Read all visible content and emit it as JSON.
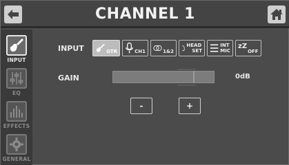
{
  "header": {
    "title": "CHANNEL 1",
    "back_icon": "arrow-left-icon",
    "home_icon": "home-icon"
  },
  "sidebar": {
    "items": [
      {
        "label": "INPUT",
        "icon": "guitar-icon",
        "active": true
      },
      {
        "label": "EQ",
        "icon": "eq-sliders-icon",
        "active": false
      },
      {
        "label": "EFFECTS",
        "icon": "effects-bars-icon",
        "active": false
      },
      {
        "label": "GENERAL",
        "icon": "gear-icon",
        "active": false
      }
    ]
  },
  "input": {
    "label": "INPUT",
    "options": [
      {
        "icon": "guitar-icon",
        "label": "GTR",
        "selected": true
      },
      {
        "icon": "microphone-icon",
        "label": "CH1",
        "selected": false
      },
      {
        "icon": "link-rings-icon",
        "label": "1&2",
        "selected": false
      },
      {
        "icon": "headset-icon",
        "label_top": "HEAD",
        "label_bottom": "SET",
        "selected": false
      },
      {
        "icon": "lines-icon",
        "label_top": "INT",
        "label_bottom": "MIC",
        "selected": false
      },
      {
        "icon": "sleep-icon",
        "glyph": "zZ",
        "label": "OFF",
        "selected": false
      }
    ]
  },
  "gain": {
    "label": "GAIN",
    "value": "0dB",
    "minus_label": "-",
    "plus_label": "+"
  },
  "colors": {
    "background": "#4b4b4b",
    "sidebar": "#3a3a3a",
    "selected_button": "#bcbcbc",
    "text": "#e8e8e8"
  }
}
